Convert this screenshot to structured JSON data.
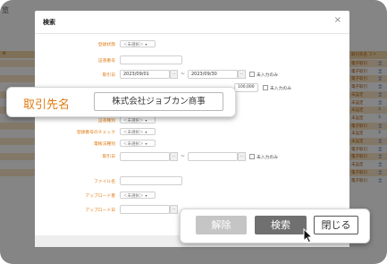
{
  "background": {
    "title": "览",
    "left_header": "书",
    "right_header": "取引先名 ファ",
    "right_rows": [
      {
        "company": "電子取引",
        "doc": "全"
      },
      {
        "company": "電子取引",
        "doc": "全"
      },
      {
        "company": "電子取引",
        "doc": "全"
      },
      {
        "company": "電子取引",
        "doc": "全"
      },
      {
        "company": "未設定",
        "doc": "全"
      },
      {
        "company": "未設定",
        "doc": "全"
      },
      {
        "company": "未設定",
        "doc": "3"
      },
      {
        "company": "未設定",
        "doc": "3"
      },
      {
        "company": "電子取引",
        "doc": "全"
      },
      {
        "company": "未設定",
        "doc": "3"
      },
      {
        "company": "未設定",
        "doc": "全"
      },
      {
        "company": "電子取引",
        "doc": "全"
      },
      {
        "company": "電子取引",
        "doc": "全"
      },
      {
        "company": "未設定",
        "doc": "全"
      },
      {
        "company": "電子取引",
        "doc": "全"
      },
      {
        "company": "電子取引",
        "doc": "全"
      }
    ]
  },
  "dialog": {
    "title": "検索",
    "close_glyph": "×",
    "select_unselected": "＜未選択＞",
    "tilde": "~",
    "calendar_glyph": "..",
    "no_input_label": "未入力のみ",
    "fields": {
      "registration_status": "登録状態",
      "doc_number": "証憑番号",
      "transaction_date": "取引日",
      "date_from": "2023/09/01",
      "date_to": "2023/09/30",
      "amount_to": "100,000",
      "doc_type": "証憑種別",
      "reg_number_check": "登録番号のチェック",
      "e_book_type": "電帳法種別",
      "transaction_date2": "取引日",
      "file_name": "ファイル名",
      "uploader": "アップロード者",
      "upload_date": "アップロード日"
    }
  },
  "callout": {
    "label": "取引先名",
    "value": "株式会社ジョブカン商事"
  },
  "buttons": {
    "clear": "解除",
    "search": "検索",
    "close": "閉じる"
  },
  "colors": {
    "label_orange": "#e07c12",
    "search_button": "#707070",
    "clear_button": "#c5c5c5"
  }
}
